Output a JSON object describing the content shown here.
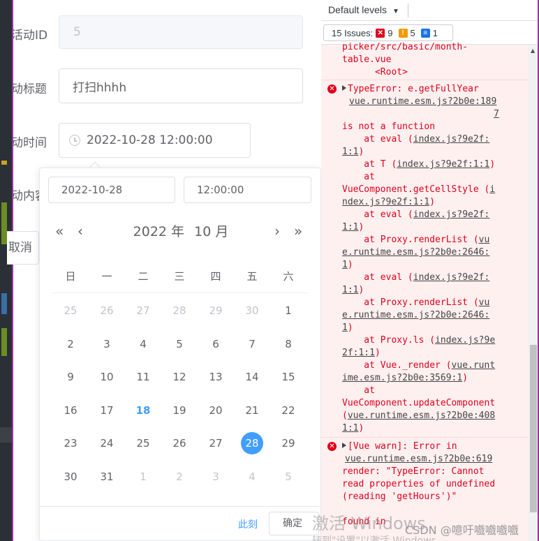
{
  "form": {
    "id_label": "活动ID",
    "id_value": "5",
    "title_label": "动标题",
    "title_value": "打扫hhhh",
    "time_label": "动时间",
    "time_value": "2022-10-28 12:00:00",
    "content_label": "动内容",
    "cancel_label": "取消"
  },
  "picker": {
    "date_input": "2022-10-28",
    "time_input": "12:00:00",
    "year_label": "2022 年",
    "month_label": "10 月",
    "prev_year": "«",
    "prev_month": "‹",
    "next_month": "›",
    "next_year": "»",
    "weekdays": [
      "日",
      "一",
      "二",
      "三",
      "四",
      "五",
      "六"
    ],
    "weeks": [
      [
        "25",
        "26",
        "27",
        "28",
        "29",
        "30",
        "1"
      ],
      [
        "2",
        "3",
        "4",
        "5",
        "6",
        "7",
        "8"
      ],
      [
        "9",
        "10",
        "11",
        "12",
        "13",
        "14",
        "15"
      ],
      [
        "16",
        "17",
        "18",
        "19",
        "20",
        "21",
        "22"
      ],
      [
        "23",
        "24",
        "25",
        "26",
        "27",
        "28",
        "29"
      ],
      [
        "30",
        "31",
        "1",
        "2",
        "3",
        "4",
        "5"
      ]
    ],
    "today": "18",
    "selected": "28",
    "now_label": "此刻",
    "ok_label": "确定"
  },
  "devtools": {
    "levels_label": "Default levels",
    "issues_label": "15 Issues:",
    "issues_errors": "9",
    "issues_warnings": "5",
    "issues_info": "1",
    "accent_error": "#e0001b",
    "accent_warning": "#f29900",
    "accent_info": "#1a73e8",
    "top_lines": [
      "picker/src/basic/month-",
      "table.vue",
      "      <Root>"
    ],
    "error1": {
      "head": "TypeError: e.getFullYear",
      "source": "vue.runtime.esm.js?2b0e:189",
      "source2": "7",
      "lines": [
        {
          "pre": "is not a function",
          "link": "",
          "post": ""
        },
        {
          "pre": "    at eval (",
          "link": "index.js?9e2f:",
          "post": ""
        },
        {
          "pre": "",
          "link": "1:1",
          "post": ")"
        },
        {
          "pre": "    at T (",
          "link": "index.js?9e2f:1:1",
          "post": ")"
        },
        {
          "pre": "    at",
          "link": "",
          "post": ""
        },
        {
          "pre": "VueComponent.getCellStyle (",
          "link": "i",
          "post": ""
        },
        {
          "pre": "",
          "link": "ndex.js?9e2f:1:1",
          "post": ")"
        },
        {
          "pre": "    at eval (",
          "link": "index.js?9e2f:",
          "post": ""
        },
        {
          "pre": "",
          "link": "1:1",
          "post": ")"
        },
        {
          "pre": "    at Proxy.renderList (",
          "link": "vu",
          "post": ""
        },
        {
          "pre": "",
          "link": "e.runtime.esm.js?2b0e:2646:",
          "post": ""
        },
        {
          "pre": "",
          "link": "1",
          "post": ")"
        },
        {
          "pre": "    at eval (",
          "link": "index.js?9e2f:",
          "post": ""
        },
        {
          "pre": "",
          "link": "1:1",
          "post": ")"
        },
        {
          "pre": "    at Proxy.renderList (",
          "link": "vu",
          "post": ""
        },
        {
          "pre": "",
          "link": "e.runtime.esm.js?2b0e:2646:",
          "post": ""
        },
        {
          "pre": "",
          "link": "1",
          "post": ")"
        },
        {
          "pre": "    at Proxy.ls (",
          "link": "index.js?9e",
          "post": ""
        },
        {
          "pre": "",
          "link": "2f:1:1",
          "post": ")"
        },
        {
          "pre": "    at Vue._render (",
          "link": "vue.runt",
          "post": ""
        },
        {
          "pre": "",
          "link": "ime.esm.js?2b0e:3569:1",
          "post": ")"
        },
        {
          "pre": "    at",
          "link": "",
          "post": ""
        },
        {
          "pre": "VueComponent.updateComponent",
          "link": "",
          "post": ""
        },
        {
          "pre": "(",
          "link": "vue.runtime.esm.js?2b0e:408",
          "post": ""
        },
        {
          "pre": "",
          "link": "1:1",
          "post": ")"
        }
      ]
    },
    "error2": {
      "head": "[Vue warn]: Error in",
      "source": "vue.runtime.esm.js?2b0e:619",
      "lines": [
        "render: \"TypeError: Cannot",
        "read properties of undefined",
        "(reading 'getHours')\""
      ],
      "tail": "found in"
    }
  },
  "watermark": {
    "line1": "激活 Windows",
    "line2": "转到\"设置\"以激活 Windows。",
    "credit": "CSDN @噫吁嚱嚱嚱嚱"
  }
}
